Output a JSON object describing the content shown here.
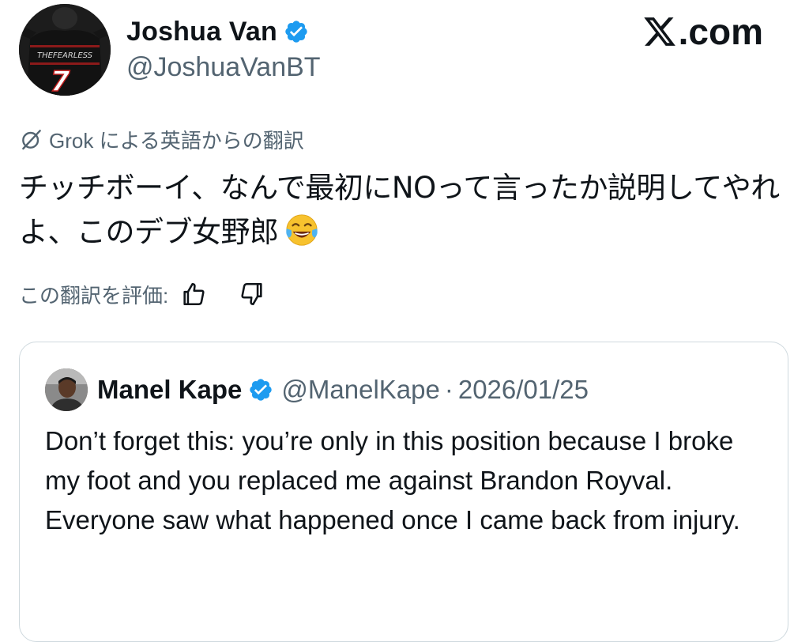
{
  "post": {
    "author_name": "Joshua Van",
    "author_handle": "@JoshuaVanBT",
    "avatar_jersey_text": "THEFEARLESS",
    "avatar_jersey_number": "7",
    "site_label": ".com",
    "translated_by": "Grok による英語からの翻訳",
    "text": "チッチボーイ、なんで最初にNOって言ったか説明してやれよ、このデブ女野郎",
    "emoji": "face-with-tears-of-joy",
    "rate_label": "この翻訳を評価:",
    "rate_icons": [
      "thumbs-up-icon",
      "thumbs-down-icon"
    ]
  },
  "quote": {
    "author_name": "Manel Kape",
    "author_handle": "@ManelKape",
    "separator": "·",
    "date": "2026/01/25",
    "text": "Don’t forget this: you’re only in this position because I broke my foot and you replaced me against Brandon Royval.\nEveryone saw what happened once I came back from injury."
  },
  "colors": {
    "text_primary": "#0f1419",
    "text_secondary": "#536471",
    "verified_blue": "#1d9bf0",
    "card_border": "#cfd9de"
  }
}
